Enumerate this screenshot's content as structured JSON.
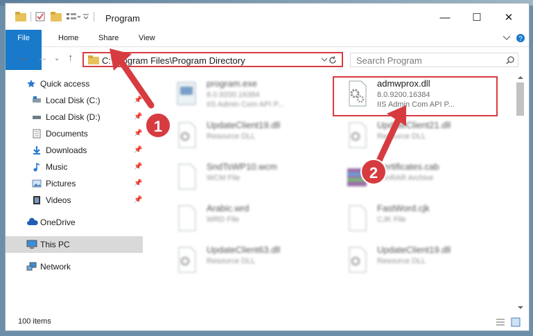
{
  "title": "Program",
  "ribbon": {
    "file": "File",
    "home": "Home",
    "share": "Share",
    "view": "View"
  },
  "address": {
    "path": "C:\\Program Files\\Program Directory"
  },
  "search": {
    "placeholder": "Search Program"
  },
  "sidebar": {
    "items": [
      {
        "label": "Quick access",
        "icon": "star-icon"
      },
      {
        "label": "Local Disk (C:)",
        "icon": "drive-icon"
      },
      {
        "label": "Local Disk (D:)",
        "icon": "drive-icon"
      },
      {
        "label": "Documents",
        "icon": "document-icon"
      },
      {
        "label": "Downloads",
        "icon": "download-icon"
      },
      {
        "label": "Music",
        "icon": "music-icon"
      },
      {
        "label": "Pictures",
        "icon": "picture-icon"
      },
      {
        "label": "Videos",
        "icon": "video-icon"
      },
      {
        "label": "OneDrive",
        "icon": "cloud-icon"
      },
      {
        "label": "This PC",
        "icon": "computer-icon"
      },
      {
        "label": "Network",
        "icon": "network-icon"
      }
    ]
  },
  "files": [
    {
      "name": "program.exe",
      "line1": "8.0.9200.16384",
      "line2": "IIS Admin Com API P..."
    },
    {
      "name": "admwprox.dll",
      "line1": "8.0.9200.16384",
      "line2": "IIS Admin Com API P..."
    },
    {
      "name": "UpdateClient19.dll",
      "line1": "Resource DLL",
      "line2": ""
    },
    {
      "name": "UpdateClient21.dll",
      "line1": "Resource DLL",
      "line2": ""
    },
    {
      "name": "SndTsWP10.wcm",
      "line1": "WCM File",
      "line2": ""
    },
    {
      "name": "Certificates.cab",
      "line1": "WinRAR Archive",
      "line2": ""
    },
    {
      "name": "Arabic.wrd",
      "line1": "WRD File",
      "line2": ""
    },
    {
      "name": "FastWord.cjk",
      "line1": "CJK File",
      "line2": ""
    },
    {
      "name": "UpdateClient63.dll",
      "line1": "Resource DLL",
      "line2": ""
    },
    {
      "name": "UpdateClient19.dll",
      "line1": "Resource DLL",
      "line2": ""
    }
  ],
  "status": {
    "count": "100 items"
  },
  "callouts": {
    "one": "1",
    "two": "2"
  },
  "colors": {
    "accent": "#1979ca",
    "highlight": "#d63b40"
  }
}
